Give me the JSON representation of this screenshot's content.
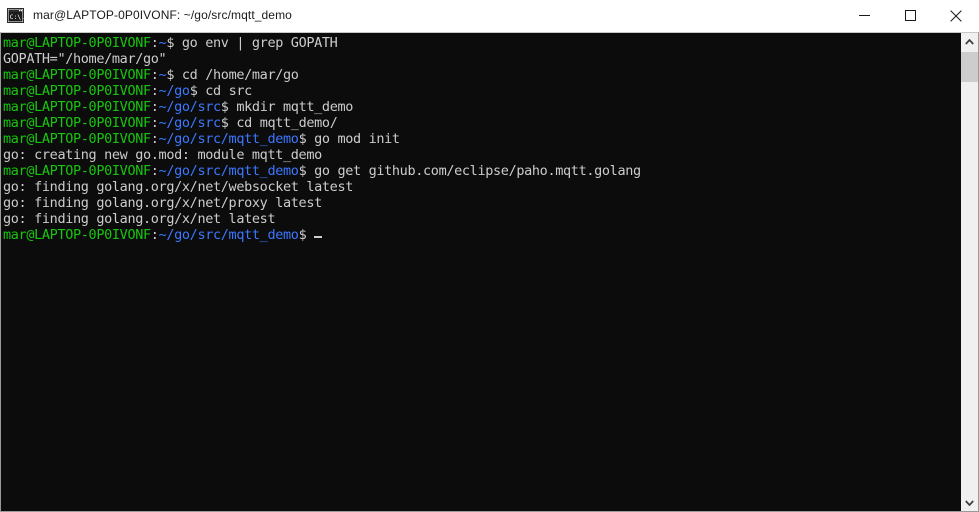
{
  "window": {
    "title": "mar@LAPTOP-0P0IVONF: ~/go/src/mqtt_demo",
    "icon": "console-icon",
    "controls": {
      "minimize_label": "Minimize",
      "maximize_label": "Maximize",
      "close_label": "Close"
    }
  },
  "theme": {
    "background": "#0c0c0c",
    "foreground": "#cccccc",
    "prompt_user": "#16c60c",
    "prompt_path": "#3b78ff",
    "titlebar_bg": "#ffffff",
    "scrollbar_track": "#f0f0f0",
    "scrollbar_thumb": "#cdcdcd"
  },
  "terminal": {
    "user_host": "mar@LAPTOP-0P0IVONF",
    "colon": ":",
    "dollar": "$",
    "cursor": "block-cursor",
    "lines": [
      {
        "type": "prompt",
        "path": "~",
        "command": " go env | grep GOPATH"
      },
      {
        "type": "output",
        "text": "GOPATH=\"/home/mar/go\""
      },
      {
        "type": "prompt",
        "path": "~",
        "command": " cd /home/mar/go"
      },
      {
        "type": "prompt",
        "path": "~/go",
        "command": " cd src"
      },
      {
        "type": "prompt",
        "path": "~/go/src",
        "command": " mkdir mqtt_demo"
      },
      {
        "type": "prompt",
        "path": "~/go/src",
        "command": " cd mqtt_demo/"
      },
      {
        "type": "prompt",
        "path": "~/go/src/mqtt_demo",
        "command": " go mod init"
      },
      {
        "type": "output",
        "text": "go: creating new go.mod: module mqtt_demo"
      },
      {
        "type": "prompt",
        "path": "~/go/src/mqtt_demo",
        "command": " go get github.com/eclipse/paho.mqtt.golang"
      },
      {
        "type": "output",
        "text": "go: finding golang.org/x/net/websocket latest"
      },
      {
        "type": "output",
        "text": "go: finding golang.org/x/net/proxy latest"
      },
      {
        "type": "output",
        "text": "go: finding golang.org/x/net latest"
      },
      {
        "type": "prompt",
        "path": "~/go/src/mqtt_demo",
        "command": "",
        "cursor": true
      }
    ]
  },
  "scrollbar": {
    "up_arrow": "chevron-up-icon",
    "down_arrow": "chevron-down-icon",
    "thumb": "scrollbar-thumb"
  }
}
